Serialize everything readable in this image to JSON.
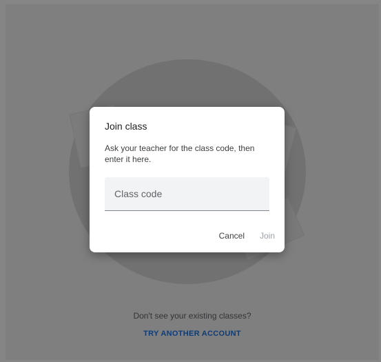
{
  "background": {
    "prompt": "Don't see your existing classes?",
    "try_another_account": "TRY ANOTHER ACCOUNT"
  },
  "dialog": {
    "title": "Join class",
    "description": "Ask your teacher for the class code, then enter it here.",
    "class_code": {
      "value": "",
      "placeholder": "Class code"
    },
    "cancel_label": "Cancel",
    "join_label": "Join",
    "join_enabled": false
  },
  "colors": {
    "link": "#1a73e8",
    "scrim": "rgba(0,0,0,0.48)",
    "dialog_bg": "#ffffff",
    "field_bg": "#f1f3f4",
    "disabled_text": "#9aa0a6"
  }
}
